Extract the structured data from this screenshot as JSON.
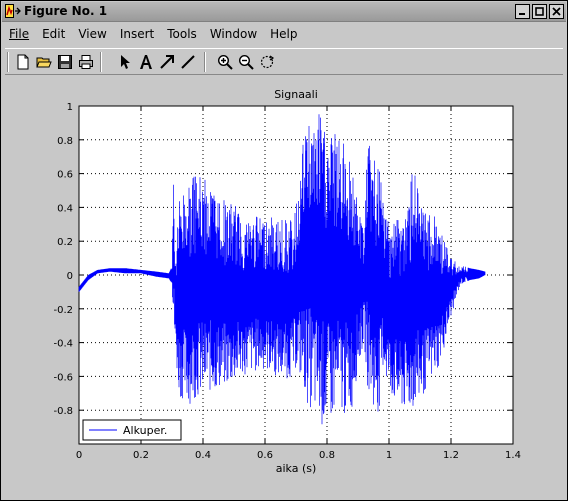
{
  "window": {
    "title": "Figure No. 1"
  },
  "menubar": {
    "items": [
      "File",
      "Edit",
      "View",
      "Insert",
      "Tools",
      "Window",
      "Help"
    ]
  },
  "toolbar": {
    "tools": [
      "new-file-icon",
      "open-folder-icon",
      "save-icon",
      "print-icon",
      "select-arrow-icon",
      "text-tool-icon",
      "arrow-tool-icon",
      "line-tool-icon",
      "zoom-in-icon",
      "zoom-out-icon",
      "rotate-icon"
    ]
  },
  "colors": {
    "signal": "#0000ff",
    "plot_bg": "#ffffff",
    "figure_bg": "#c8c8c8"
  },
  "chart_data": {
    "type": "line",
    "title": "Signaali",
    "xlabel": "aika (s)",
    "ylabel": "",
    "xlim": [
      0,
      1.4
    ],
    "ylim": [
      -1,
      1
    ],
    "xticks": [
      0,
      0.2,
      0.4,
      0.6,
      0.8,
      1,
      1.2,
      1.4
    ],
    "xtick_labels": [
      "0",
      "0.2",
      "0.4",
      "0.6",
      "0.8",
      "1",
      "1.2",
      "1.4"
    ],
    "yticks": [
      -0.8,
      -0.6,
      -0.4,
      -0.2,
      0,
      0.2,
      0.4,
      0.6,
      0.8,
      1
    ],
    "ytick_labels": [
      "-0.8",
      "-0.6",
      "-0.4",
      "-0.2",
      "0",
      "0.2",
      "0.4",
      "0.6",
      "0.8",
      "1"
    ],
    "grid": true,
    "legend_position": "bottom-left",
    "series": [
      {
        "name": "Alkuper.",
        "color": "#0000ff",
        "envelope": [
          [
            0.0,
            -0.1,
            -0.07
          ],
          [
            0.03,
            -0.03,
            0.0
          ],
          [
            0.06,
            0.01,
            0.03
          ],
          [
            0.1,
            0.02,
            0.04
          ],
          [
            0.15,
            0.01,
            0.04
          ],
          [
            0.2,
            0.01,
            0.03
          ],
          [
            0.25,
            -0.01,
            0.02
          ],
          [
            0.29,
            -0.02,
            0.01
          ],
          [
            0.3,
            -0.05,
            0.05
          ],
          [
            0.305,
            -0.35,
            0.75
          ],
          [
            0.31,
            -0.4,
            0.05
          ],
          [
            0.32,
            -0.7,
            0.45
          ],
          [
            0.35,
            -0.78,
            0.55
          ],
          [
            0.38,
            -0.72,
            0.6
          ],
          [
            0.4,
            -0.72,
            0.57
          ],
          [
            0.42,
            -0.7,
            0.55
          ],
          [
            0.45,
            -0.68,
            0.48
          ],
          [
            0.48,
            -0.66,
            0.42
          ],
          [
            0.5,
            -0.64,
            0.42
          ],
          [
            0.53,
            -0.6,
            0.35
          ],
          [
            0.56,
            -0.58,
            0.35
          ],
          [
            0.6,
            -0.56,
            0.35
          ],
          [
            0.63,
            -0.6,
            0.34
          ],
          [
            0.66,
            -0.62,
            0.33
          ],
          [
            0.69,
            -0.6,
            0.33
          ],
          [
            0.7,
            -0.55,
            0.4
          ],
          [
            0.72,
            -0.65,
            0.75
          ],
          [
            0.74,
            -0.78,
            0.95
          ],
          [
            0.76,
            -0.82,
            0.9
          ],
          [
            0.78,
            -0.9,
            0.98
          ],
          [
            0.8,
            -0.88,
            0.82
          ],
          [
            0.82,
            -0.85,
            0.85
          ],
          [
            0.84,
            -0.82,
            0.8
          ],
          [
            0.86,
            -0.84,
            0.78
          ],
          [
            0.88,
            -0.8,
            0.7
          ],
          [
            0.9,
            -0.55,
            0.4
          ],
          [
            0.92,
            -0.4,
            0.3
          ],
          [
            0.93,
            -0.65,
            0.8
          ],
          [
            0.95,
            -0.8,
            0.7
          ],
          [
            0.97,
            -0.82,
            0.62
          ],
          [
            0.98,
            -0.55,
            0.45
          ],
          [
            1.0,
            -0.7,
            0.35
          ],
          [
            1.03,
            -0.8,
            0.38
          ],
          [
            1.06,
            -0.82,
            0.4
          ],
          [
            1.08,
            -0.8,
            0.7
          ],
          [
            1.1,
            -0.75,
            0.4
          ],
          [
            1.13,
            -0.65,
            0.38
          ],
          [
            1.16,
            -0.55,
            0.32
          ],
          [
            1.18,
            -0.42,
            0.2
          ],
          [
            1.2,
            -0.25,
            0.1
          ],
          [
            1.23,
            -0.06,
            0.06
          ],
          [
            1.26,
            -0.03,
            0.04
          ],
          [
            1.29,
            -0.02,
            0.03
          ],
          [
            1.31,
            0.0,
            0.02
          ]
        ]
      }
    ]
  }
}
